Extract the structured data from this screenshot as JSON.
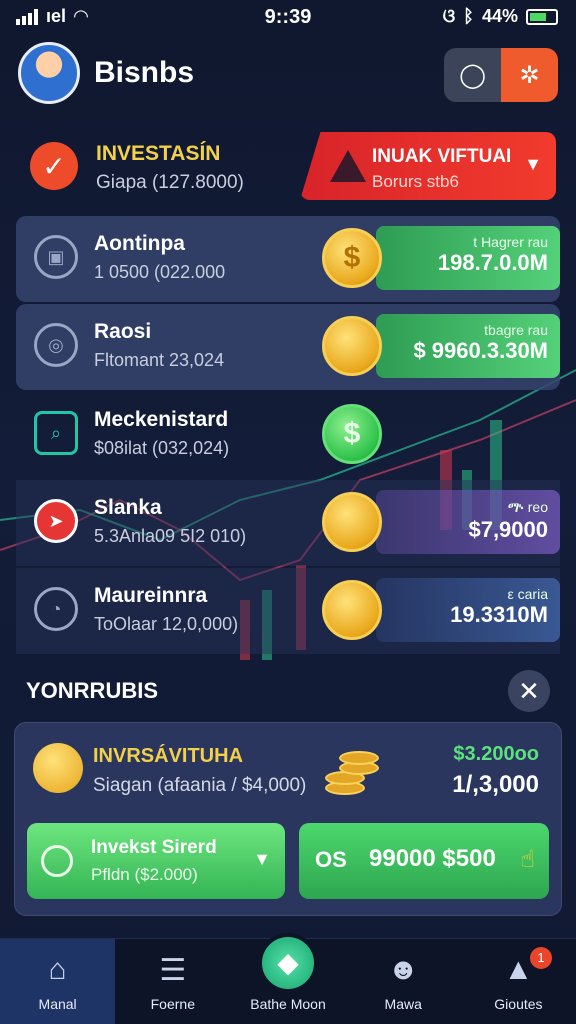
{
  "status_bar": {
    "carrier": "ıel",
    "time": "9::39",
    "icons_right": "ଓ",
    "battery": "44%"
  },
  "header": {
    "title": "Bisnbs",
    "left_button_icon": "circle-icon",
    "right_button_icon": "settings-icon"
  },
  "invest": {
    "title": "INVESTASÍN",
    "subtitle": "Giapa (127.8000)"
  },
  "alert": {
    "title": "INUAK VIFTUAI",
    "subtitle": "Borurs stb6"
  },
  "list": [
    {
      "name": "Aontinpa",
      "sub": "1 0500 (022.000",
      "coin": "$",
      "label": "t Hagrer rau",
      "amount": "198.7.0.0M",
      "style": "green"
    },
    {
      "name": "Raosi",
      "sub": "Fltomant 23,024",
      "coin": "",
      "label": "tbagre rau",
      "amount": "$ 9960.3.30M",
      "style": "green"
    },
    {
      "name": "Meckenistard",
      "sub": "$08ilat (032,024)",
      "coin": "$",
      "label": "",
      "amount": "",
      "style": "none"
    },
    {
      "name": "Slanka",
      "sub": "5.3Anla09 5I2 010)",
      "coin": "",
      "label": "ᎁ reo",
      "amount": "$7,9000",
      "style": "purple"
    },
    {
      "name": "Maureinnra",
      "sub": "ToOlaar 12,0,000)",
      "coin": "",
      "label": "ε caria",
      "amount": "19.3310M",
      "style": "blue"
    }
  ],
  "section": {
    "title": "YONRRUBIS",
    "close": "✕"
  },
  "panel": {
    "title": "INVRSÁVITUHA",
    "subtitle": "Siagan (afaania / $4,000)",
    "amount_top": "$3.200oo",
    "amount_main": "1/,3,000",
    "btn_left_title": "Invekst Sirerd",
    "btn_left_sub": "Pfldn ($2.000)",
    "btn_right_prefix": "OS",
    "btn_right_amount": "99000 $500"
  },
  "tabs": [
    {
      "label": "Manal",
      "icon": "home-icon"
    },
    {
      "label": "Foerne",
      "icon": "document-icon"
    },
    {
      "label": "Bathe Moon",
      "icon": "portfolio-icon"
    },
    {
      "label": "Mawa",
      "icon": "people-icon"
    },
    {
      "label": "Gioutes",
      "icon": "alert-icon",
      "badge": "1"
    }
  ],
  "colors": {
    "accent_green": "#34b455",
    "alert_red": "#e02a2a",
    "gold": "#f2d04a",
    "bg": "#131c38"
  }
}
